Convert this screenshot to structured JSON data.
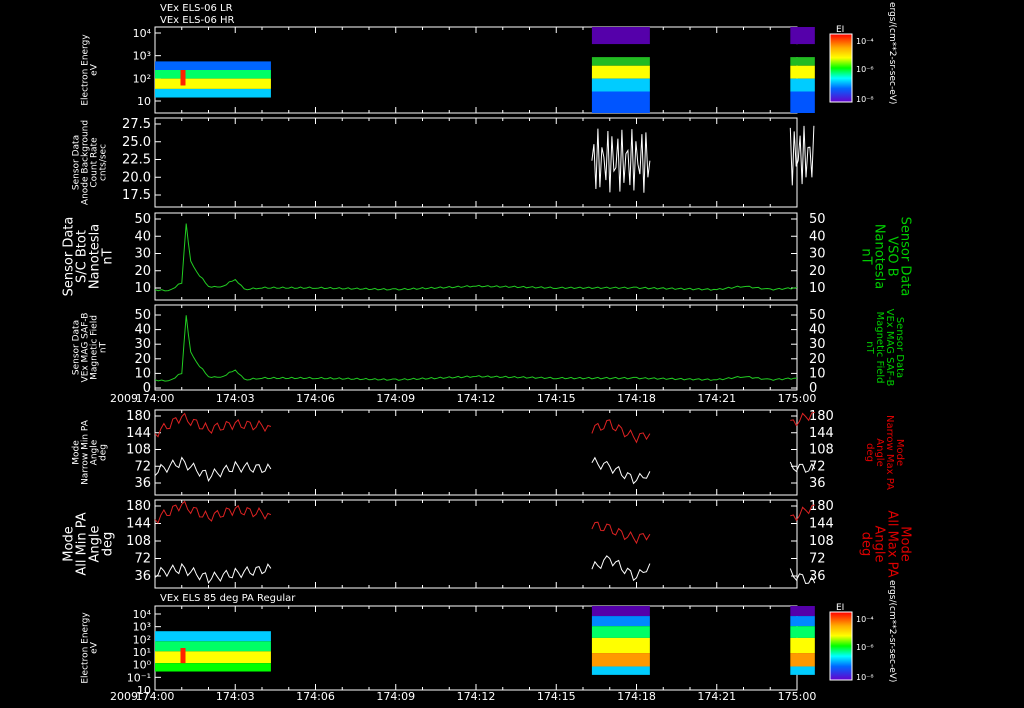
{
  "header": {
    "line1": "VEx ELS-06 LR",
    "line2": "VEx ELS-06 HR",
    "bottom_panel_title": "VEx ELS 85 deg PA Regular"
  },
  "time_axis": {
    "year": "2009",
    "ticks": [
      "174:00",
      "174:03",
      "174:06",
      "174:09",
      "174:12",
      "174:15",
      "174:18",
      "174:21",
      "175:00"
    ]
  },
  "colorbar_top": {
    "label": "EI",
    "ticks": [
      "10⁻⁴",
      "10⁻⁶",
      "10⁻⁸"
    ],
    "side_label": "ergs/(cm**2-sr-sec-eV)"
  },
  "colorbar_bottom": {
    "label": "EI",
    "ticks": [
      "10⁻⁴",
      "10⁻⁶",
      "10⁻⁸"
    ],
    "side_label": "ergs/(cm**2-sr-sec-eV)"
  },
  "colors": {
    "background": "#000000",
    "axis": "#ffffff",
    "line_green": "#22cc22",
    "line_red": "#dd2222",
    "line_white": "#ffffff",
    "label_green": "#00cc00",
    "label_red": "#dd0000"
  },
  "chart_data": [
    {
      "id": "panel1",
      "type": "heatmap",
      "ylabel": [
        "Electron Energy",
        "eV"
      ],
      "yscale": "log",
      "ylim": [
        1,
        20000
      ],
      "ytick_labels": [
        "10⁴",
        "10³",
        "10²",
        "10"
      ],
      "segments": [
        {
          "start": "174:00",
          "end": "174:04:20"
        },
        {
          "start": "174:16:20",
          "end": "174:18:30"
        },
        {
          "start": "174:23:45",
          "end": "174:24:40"
        }
      ]
    },
    {
      "id": "panel2",
      "type": "line",
      "ylabel": [
        "Sensor Data",
        "Anode Background",
        "Count Rate",
        "cnts/sec"
      ],
      "ylim": [
        15,
        27.5
      ],
      "ytick_labels": [
        "27.5",
        "25.0",
        "22.5",
        "20.0",
        "17.5"
      ],
      "series": [
        {
          "color": "#ffffff",
          "x": [
            "174:16:20",
            "174:18:30"
          ],
          "y_range": [
            17,
            26
          ]
        },
        {
          "color": "#ffffff",
          "x": [
            "174:23:45",
            "174:24:40"
          ],
          "y_range": [
            18,
            26.5
          ]
        }
      ]
    },
    {
      "id": "panel3",
      "type": "line",
      "ylabel": [
        "Sensor Data",
        "S/C Btot",
        "Nanotesla",
        "nT"
      ],
      "ylabel_right": [
        "Sensor Data",
        "VSO B",
        "Nanotesla",
        "nT"
      ],
      "ylim": [
        0,
        50
      ],
      "ytick_labels": [
        "50",
        "40",
        "30",
        "20",
        "10"
      ],
      "x": [
        "174:00",
        "174:00:30",
        "174:01",
        "174:01:10",
        "174:01:20",
        "174:01:40",
        "174:02",
        "174:02:20",
        "174:02:40",
        "174:03",
        "174:03:20",
        "174:04",
        "174:06",
        "174:09",
        "174:12",
        "174:15",
        "174:18",
        "174:21",
        "174:22",
        "174:23",
        "175:00"
      ],
      "values": [
        6,
        5,
        10,
        44,
        22,
        14,
        8,
        7,
        9,
        12,
        6,
        7,
        7,
        6,
        8,
        7,
        7,
        6,
        8,
        6,
        7
      ]
    },
    {
      "id": "panel4",
      "type": "line",
      "ylabel": [
        "Sensor Data",
        "VEx MAG SAF-B",
        "Magnetic Field",
        "nT"
      ],
      "ylabel_right": [
        "Sensor Data",
        "VEx MAG SAF-B",
        "Magnetic Field",
        "nT"
      ],
      "ylim": [
        0,
        50
      ],
      "ytick_labels": [
        "50",
        "40",
        "30",
        "20",
        "10",
        "0"
      ],
      "x": [
        "174:00",
        "174:00:30",
        "174:01",
        "174:01:10",
        "174:01:20",
        "174:01:40",
        "174:02",
        "174:02:20",
        "174:02:40",
        "174:03",
        "174:03:20",
        "174:04",
        "174:06",
        "174:09",
        "174:12",
        "174:15",
        "174:18",
        "174:21",
        "174:22",
        "174:23",
        "175:00"
      ],
      "values": [
        6,
        5,
        10,
        44,
        22,
        14,
        8,
        7,
        9,
        12,
        6,
        7,
        7,
        6,
        8,
        7,
        7,
        6,
        8,
        6,
        7
      ]
    },
    {
      "id": "panel5",
      "type": "line",
      "ylabel": [
        "Mode",
        "Narrow Min PA",
        "Angle",
        "deg"
      ],
      "ylabel_right": [
        "Mode",
        "Narrow Max PA",
        "Angle",
        "deg"
      ],
      "ylim": [
        0,
        180
      ],
      "ytick_labels": [
        "180",
        "144",
        "108",
        "72",
        "36"
      ],
      "series": [
        {
          "color": "#dd2222",
          "x": [
            "174:00",
            "174:01",
            "174:02",
            "174:03",
            "174:04:20"
          ],
          "values": [
            130,
            165,
            140,
            150,
            145
          ]
        },
        {
          "color": "#ffffff",
          "x": [
            "174:00",
            "174:01",
            "174:02",
            "174:03",
            "174:04:20"
          ],
          "values": [
            50,
            70,
            40,
            60,
            55
          ]
        },
        {
          "color": "#dd2222",
          "x": [
            "174:16:20",
            "174:17",
            "174:18",
            "174:18:30"
          ],
          "values": [
            140,
            150,
            120,
            130
          ]
        },
        {
          "color": "#ffffff",
          "x": [
            "174:16:20",
            "174:17",
            "174:18",
            "174:18:30"
          ],
          "values": [
            70,
            60,
            30,
            50
          ]
        },
        {
          "color": "#dd2222",
          "x": [
            "174:23:45",
            "174:24:40"
          ],
          "values": [
            150,
            175
          ]
        },
        {
          "color": "#ffffff",
          "x": [
            "174:23:45",
            "174:24:40"
          ],
          "values": [
            60,
            55
          ]
        }
      ]
    },
    {
      "id": "panel6",
      "type": "line",
      "ylabel": [
        "Mode",
        "All Min PA",
        "Angle",
        "deg"
      ],
      "ylabel_right": [
        "Mode",
        "All Max PA",
        "Angle",
        "deg"
      ],
      "ylim": [
        0,
        180
      ],
      "ytick_labels": [
        "180",
        "144",
        "108",
        "72",
        "36"
      ],
      "series": [
        {
          "color": "#dd2222",
          "x": [
            "174:00",
            "174:01",
            "174:02",
            "174:03",
            "174:04:20"
          ],
          "values": [
            140,
            170,
            145,
            160,
            150
          ]
        },
        {
          "color": "#ffffff",
          "x": [
            "174:00",
            "174:01",
            "174:02",
            "174:03",
            "174:04:20"
          ],
          "values": [
            30,
            40,
            20,
            30,
            40
          ]
        },
        {
          "color": "#dd2222",
          "x": [
            "174:16:20",
            "174:17",
            "174:18",
            "174:18:30"
          ],
          "values": [
            130,
            120,
            100,
            110
          ]
        },
        {
          "color": "#ffffff",
          "x": [
            "174:16:20",
            "174:17",
            "174:18",
            "174:18:30"
          ],
          "values": [
            40,
            60,
            20,
            50
          ]
        },
        {
          "color": "#dd2222",
          "x": [
            "174:23:45",
            "174:24:40"
          ],
          "values": [
            140,
            170
          ]
        },
        {
          "color": "#ffffff",
          "x": [
            "174:23:45",
            "174:24:40"
          ],
          "values": [
            30,
            10
          ]
        }
      ]
    },
    {
      "id": "panel7",
      "type": "heatmap",
      "ylabel": [
        "Electron Energy",
        "eV"
      ],
      "yscale": "log",
      "ylim": [
        10,
        20000
      ],
      "ytick_labels": [
        "10⁴",
        "10³",
        "10²",
        "10¹",
        "10⁰",
        "10⁻¹",
        "10"
      ],
      "segments": [
        {
          "start": "174:00",
          "end": "174:04:20"
        },
        {
          "start": "174:16:20",
          "end": "174:18:30"
        },
        {
          "start": "174:23:45",
          "end": "174:24:40"
        }
      ]
    }
  ]
}
